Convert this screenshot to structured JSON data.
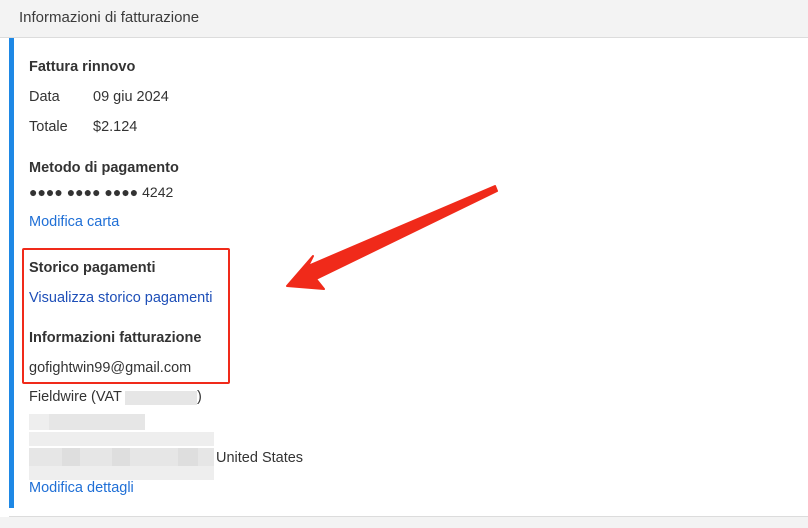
{
  "header": {
    "title": "Informazioni di fatturazione"
  },
  "renewal": {
    "heading": "Fattura rinnovo",
    "date_label": "Data",
    "date_value": "09 giu 2024",
    "total_label": "Totale",
    "total_value": "$2.124"
  },
  "payment_method": {
    "heading": "Metodo di pagamento",
    "card_masked": "●●●● ●●●● ●●●● 4242",
    "edit_link": "Modifica carta"
  },
  "payment_history": {
    "heading": "Storico pagamenti",
    "view_link": "Visualizza storico pagamenti"
  },
  "billing_info": {
    "heading": "Informazioni fatturazione",
    "email": "gofightwin99@gmail.com",
    "company": "Fieldwire (VAT",
    "company_suffix": ")",
    "country": "United States",
    "edit_link": "Modifica dettagli"
  },
  "colors": {
    "accent": "#1e88e5",
    "link": "#1f6fd6",
    "highlight": "#f02a1a",
    "arrow": "#f02a1a"
  }
}
